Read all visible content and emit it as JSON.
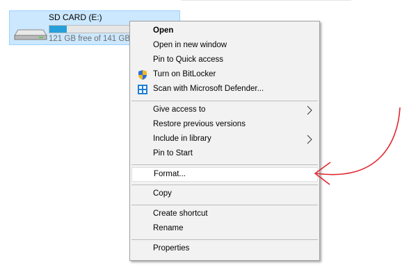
{
  "drive": {
    "name": "SD CARD (E:)",
    "free_text": "121 GB free of 141 GB",
    "used_fraction": 0.14,
    "icon": "drive-icon"
  },
  "menu": {
    "items": [
      {
        "label": "Open",
        "bold": true
      },
      {
        "label": "Open in new window"
      },
      {
        "label": "Pin to Quick access"
      },
      {
        "label": "Turn on BitLocker",
        "icon": "bitlocker-shield-icon"
      },
      {
        "label": "Scan with Microsoft Defender...",
        "icon": "defender-icon"
      },
      {
        "label": "Give access to",
        "submenu": true
      },
      {
        "label": "Restore previous versions"
      },
      {
        "label": "Include in library",
        "submenu": true
      },
      {
        "label": "Pin to Start"
      },
      {
        "label": "Format...",
        "highlighted": true
      },
      {
        "label": "Copy"
      },
      {
        "label": "Create shortcut"
      },
      {
        "label": "Rename"
      },
      {
        "label": "Properties"
      }
    ]
  },
  "colors": {
    "selection": "#cce8ff",
    "capacity_fill": "#26a0da",
    "annotation_arrow": "#e0242c"
  }
}
